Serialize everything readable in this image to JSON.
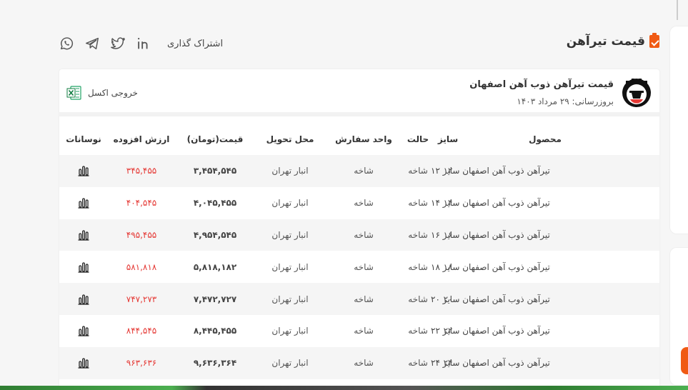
{
  "header": {
    "title": "قیمت تیرآهن",
    "share_label": "اشتراک گذاری"
  },
  "share_icons": [
    "linkedin-icon",
    "twitter-icon",
    "telegram-icon",
    "whatsapp-icon"
  ],
  "card": {
    "product_title": "قیمت تیرآهن ذوب آهن اصفهان",
    "updated": "بروزرسانی: ۲۹ مرداد ۱۴۰۳",
    "excel_label": "خروجی اکسل"
  },
  "table": {
    "headers": {
      "product": "محصول",
      "size": "سایز",
      "state": "حالت",
      "unit": "واحد سفارش",
      "place": "محل تحویل",
      "price": "قیمت(تومان)",
      "vat": "ارزش افزوده",
      "fluct": "نوسانات"
    },
    "rows": [
      {
        "product": "تیرآهن ذوب آهن اصفهان سایز ۱۲",
        "size": "۱۲",
        "state": "شاخه",
        "unit": "شاخه",
        "place": "انبار تهران",
        "price": "۳,۴۵۴,۵۴۵",
        "vat": "۳۴۵,۴۵۵"
      },
      {
        "product": "تیرآهن ذوب آهن اصفهان سایز ۱۴",
        "size": "۱۴",
        "state": "شاخه",
        "unit": "شاخه",
        "place": "انبار تهران",
        "price": "۴,۰۴۵,۴۵۵",
        "vat": "۴۰۴,۵۴۵"
      },
      {
        "product": "تیرآهن ذوب آهن اصفهان سایز ۱۶",
        "size": "۱۶",
        "state": "شاخه",
        "unit": "شاخه",
        "place": "انبار تهران",
        "price": "۴,۹۵۴,۵۴۵",
        "vat": "۴۹۵,۴۵۵"
      },
      {
        "product": "تیرآهن ذوب آهن اصفهان سایز ۱۸",
        "size": "۱۸",
        "state": "شاخه",
        "unit": "شاخه",
        "place": "انبار تهران",
        "price": "۵,۸۱۸,۱۸۲",
        "vat": "۵۸۱,۸۱۸"
      },
      {
        "product": "تیرآهن ذوب آهن اصفهان سایز ۲۰",
        "size": "۲۰",
        "state": "شاخه",
        "unit": "شاخه",
        "place": "انبار تهران",
        "price": "۷,۴۷۲,۷۲۷",
        "vat": "۷۴۷,۲۷۳"
      },
      {
        "product": "تیرآهن ذوب آهن اصفهان سایز ۲۲",
        "size": "۲۲",
        "state": "شاخه",
        "unit": "شاخه",
        "place": "انبار تهران",
        "price": "۸,۴۴۵,۴۵۵",
        "vat": "۸۴۴,۵۴۵"
      },
      {
        "product": "تیرآهن ذوب آهن اصفهان سایز ۲۴",
        "size": "۲۴",
        "state": "شاخه",
        "unit": "شاخه",
        "place": "انبار تهران",
        "price": "۹,۶۳۶,۳۶۴",
        "vat": "۹۶۳,۶۳۶"
      }
    ]
  },
  "colors": {
    "accent": "#f05a14",
    "vat_text": "#e53935",
    "row_alt": "#f5f5f5"
  }
}
